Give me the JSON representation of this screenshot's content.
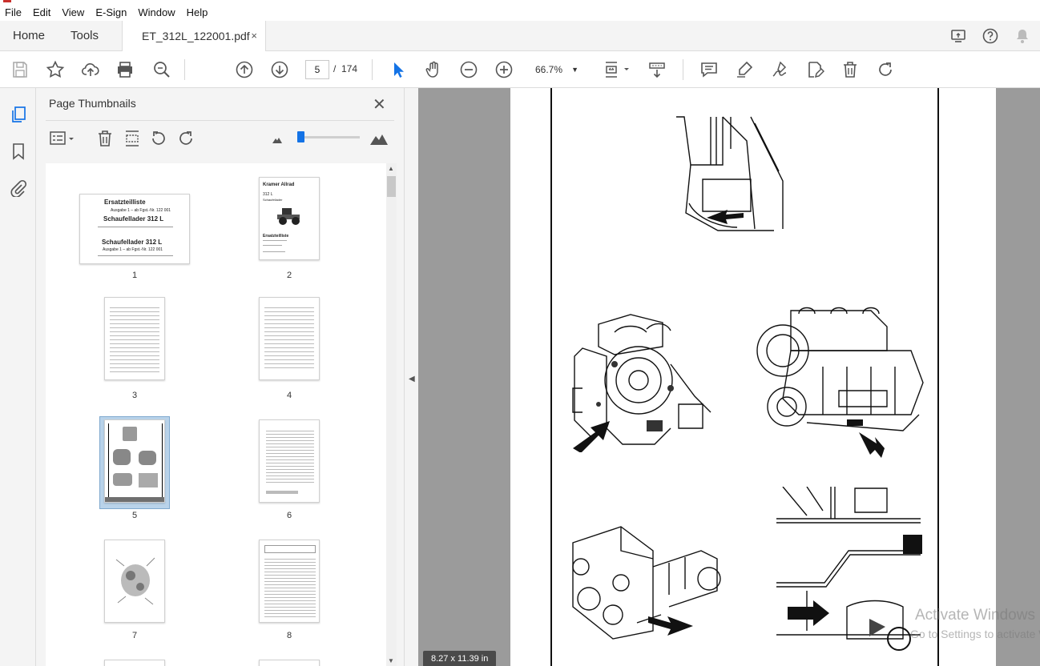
{
  "menu": {
    "items": [
      "File",
      "Edit",
      "View",
      "E-Sign",
      "Window",
      "Help"
    ]
  },
  "tabs": {
    "home": "Home",
    "tools": "Tools",
    "document": "ET_312L_122001.pdf",
    "close": "×"
  },
  "toolbar": {
    "current_page": "5",
    "page_separator": "/",
    "total_pages": "174",
    "zoom": "66.7%"
  },
  "panel": {
    "title": "Page Thumbnails",
    "close": "✕",
    "thumbnails": [
      {
        "label": "1",
        "line1": "Ersatzteilliste",
        "line2": "Ausgabe 1 – ab Fgst.-Nr. 122 001",
        "line3": "Schaufellader 312 L",
        "line4": "Schaufellader 312 L",
        "line5": "Ausgabe 1 – ab Fgst.-Nr. 122 001"
      },
      {
        "label": "2",
        "brand": "Kramer Allrad",
        "model": "312 L",
        "sub": "Schaufellader",
        "heading": "Ersatzteilliste"
      },
      {
        "label": "3"
      },
      {
        "label": "4"
      },
      {
        "label": "5",
        "selected": true
      },
      {
        "label": "6"
      },
      {
        "label": "7"
      },
      {
        "label": "8"
      }
    ]
  },
  "document": {
    "page_size": "8.27 x 11.39 in"
  },
  "watermark": {
    "line1": "Activate Windows",
    "line2": "Go to Settings to activate Windows."
  }
}
